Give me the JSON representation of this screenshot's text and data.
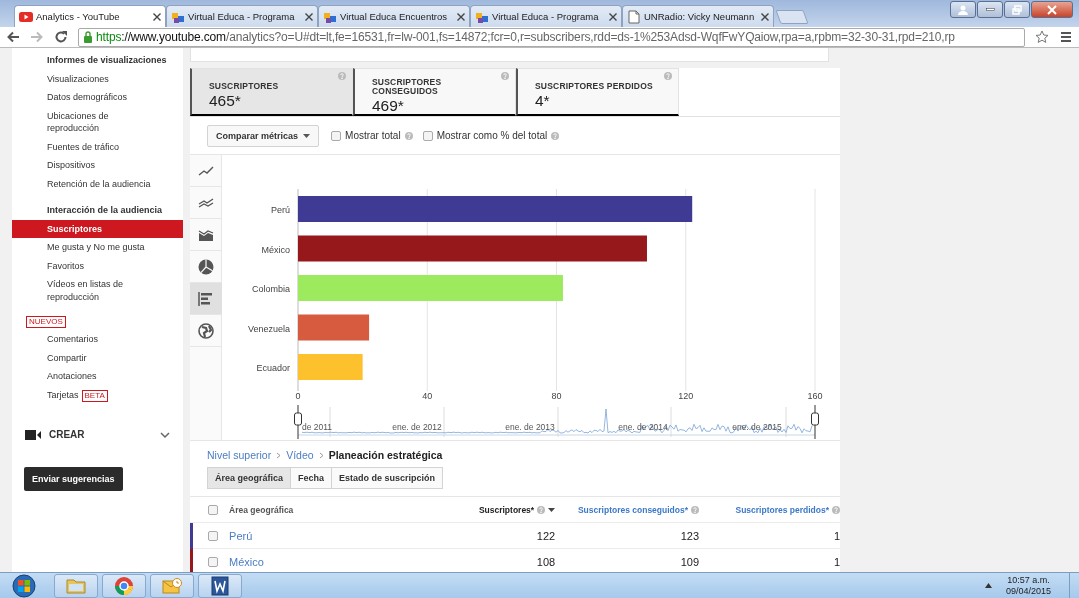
{
  "browser": {
    "tabs": [
      {
        "title": "Analytics - YouTube",
        "kind": "youtube",
        "selected": true
      },
      {
        "title": "Virtual Educa - Programa",
        "kind": "puzzle",
        "selected": false
      },
      {
        "title": "Virtual Educa Encuentros",
        "kind": "puzzle",
        "selected": false
      },
      {
        "title": "Virtual Educa - Programa",
        "kind": "puzzle",
        "selected": false
      },
      {
        "title": "UNRadio: Vicky Neumann",
        "kind": "page",
        "selected": false
      }
    ],
    "url": {
      "scheme": "https",
      "host": "://www.youtube.com",
      "path": "/analytics?o=U#dt=lt,fe=16531,fr=lw-001,fs=14872;fcr=0,r=subscribers,rdd=ds-1%253Adsd-WqfFwYQaiow,rpa=a,rpbm=32-30-31,rpd=210,rp"
    }
  },
  "sidebar": {
    "items": [
      {
        "label": "Informes de visualizaciones",
        "kind": "heading"
      },
      {
        "label": "Visualizaciones",
        "kind": "item",
        "selected": false
      },
      {
        "label": "Datos demográficos",
        "kind": "item",
        "selected": false
      },
      {
        "label": "Ubicaciones de reproducción",
        "kind": "item",
        "selected": false
      },
      {
        "label": "Fuentes de tráfico",
        "kind": "item",
        "selected": false
      },
      {
        "label": "Dispositivos",
        "kind": "item",
        "selected": false
      },
      {
        "label": "Retención de la audiencia",
        "kind": "item",
        "selected": false
      },
      {
        "label": "Interacción de la audiencia",
        "kind": "heading"
      },
      {
        "label": "Suscriptores",
        "kind": "item",
        "selected": true
      },
      {
        "label": "Me gusta y No me gusta",
        "kind": "item",
        "selected": false
      },
      {
        "label": "Favoritos",
        "kind": "item",
        "selected": false
      },
      {
        "label": "Vídeos en listas de reproducción",
        "kind": "item",
        "selected": false
      },
      {
        "label": "NUEVOS",
        "kind": "badge"
      },
      {
        "label": "Comentarios",
        "kind": "item",
        "selected": false
      },
      {
        "label": "Compartir",
        "kind": "item",
        "selected": false
      },
      {
        "label": "Anotaciones",
        "kind": "item",
        "selected": false
      },
      {
        "label": "Tarjetas",
        "kind": "item",
        "badge": "BETA",
        "selected": false
      }
    ],
    "create": {
      "label": "CREAR",
      "expanded": false
    },
    "feedback_button": "Enviar sugerencias"
  },
  "metrics": [
    {
      "label": "SUSCRIPTORES",
      "value": "465*",
      "selected": true
    },
    {
      "label": "SUSCRIPTORES CONSEGUIDOS",
      "value": "469*",
      "selected": false
    },
    {
      "label": "SUSCRIPTORES PERDIDOS",
      "value": "4*",
      "selected": false
    }
  ],
  "toolbar": {
    "compare_button": "Comparar métricas",
    "checkboxes": [
      {
        "label": "Mostrar total",
        "checked": false
      },
      {
        "label": "Mostrar como % del total",
        "checked": false
      }
    ]
  },
  "chart_types": [
    {
      "kind": "line",
      "selected": false
    },
    {
      "kind": "multiline",
      "selected": false
    },
    {
      "kind": "area",
      "selected": false
    },
    {
      "kind": "pie",
      "selected": false
    },
    {
      "kind": "bar",
      "selected": true
    },
    {
      "kind": "map",
      "selected": false
    }
  ],
  "chart": {
    "chart_data": {
      "type": "bar",
      "orientation": "horizontal",
      "categories": [
        "Perú",
        "México",
        "Colombia",
        "Venezuela",
        "Ecuador"
      ],
      "values": [
        122,
        108,
        82,
        22,
        20
      ],
      "colors": [
        "#3f3b95",
        "#96181b",
        "#9eea5e",
        "#d65b3f",
        "#fcc12c"
      ],
      "xlim": [
        0,
        160
      ],
      "xticks": [
        0,
        40,
        80,
        120,
        160
      ],
      "grid": true
    },
    "timeline_labels": [
      "de 2011",
      "ene. de 2012",
      "ene. de 2013",
      "ene. de 2014",
      "ene. de 2015"
    ]
  },
  "breadcrumb": [
    {
      "label": "Nivel superior",
      "link": true
    },
    {
      "label": "Vídeo",
      "link": true
    },
    {
      "label": "Planeación estratégica",
      "link": false
    }
  ],
  "dimension_tabs": [
    {
      "label": "Área geográfica",
      "selected": true
    },
    {
      "label": "Fecha",
      "selected": false
    },
    {
      "label": "Estado de suscripción",
      "selected": false
    }
  ],
  "table": {
    "select_all_checked": false,
    "columns": [
      {
        "label": "Área geográfica",
        "kind": "name",
        "sorted": false
      },
      {
        "label": "Suscriptores*",
        "kind": "metric",
        "sorted": true
      },
      {
        "label": "Suscriptores conseguidos*",
        "kind": "metric",
        "sorted": false
      },
      {
        "label": "Suscriptores perdidos*",
        "kind": "metric",
        "sorted": false
      }
    ],
    "rows": [
      {
        "color": "#3f3b95",
        "checked": false,
        "cells": [
          "Perú",
          "122",
          "123",
          "1"
        ]
      },
      {
        "color": "#96181b",
        "checked": false,
        "cells": [
          "México",
          "108",
          "109",
          "1"
        ]
      }
    ]
  },
  "taskbar": {
    "apps": [
      {
        "kind": "explorer"
      },
      {
        "kind": "chrome"
      },
      {
        "kind": "outlook"
      },
      {
        "kind": "word"
      }
    ],
    "time": "10:57 a.m.",
    "date": "09/04/2015"
  }
}
